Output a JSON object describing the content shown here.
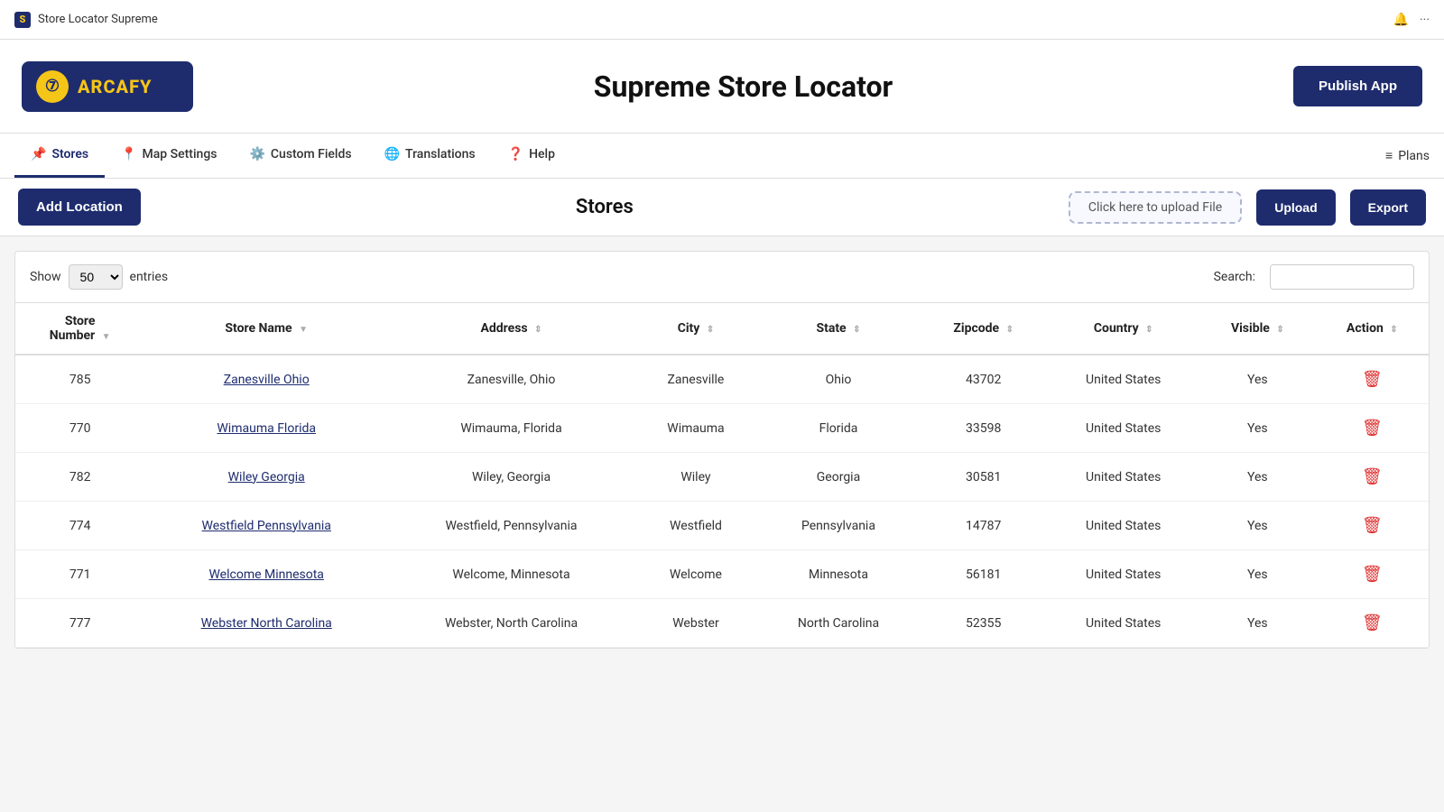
{
  "topbar": {
    "title": "Store Locator Supreme",
    "bell_icon": "🔔",
    "more_icon": "···"
  },
  "header": {
    "logo_text": "ARCAFY",
    "logo_icon_char": "⑦",
    "title": "Supreme Store Locator",
    "publish_label": "Publish App"
  },
  "nav": {
    "tabs": [
      {
        "id": "stores",
        "icon": "📌",
        "label": "Stores",
        "active": true
      },
      {
        "id": "map-settings",
        "icon": "📍",
        "label": "Map Settings",
        "active": false
      },
      {
        "id": "custom-fields",
        "icon": "⚙️",
        "label": "Custom Fields",
        "active": false
      },
      {
        "id": "translations",
        "icon": "🌐",
        "label": "Translations",
        "active": false
      },
      {
        "id": "help",
        "icon": "❓",
        "label": "Help",
        "active": false
      }
    ],
    "plans_label": "Plans",
    "plans_icon": "≡"
  },
  "toolbar": {
    "add_location_label": "Add Location",
    "page_title": "Stores",
    "upload_file_placeholder": "Click here to upload File",
    "upload_label": "Upload",
    "export_label": "Export"
  },
  "table_controls": {
    "show_label": "Show",
    "entries_value": "50",
    "entries_label": "entries",
    "search_label": "Search:"
  },
  "table": {
    "columns": [
      {
        "id": "store-number",
        "label": "Store\nNumber",
        "sortable": true
      },
      {
        "id": "store-name",
        "label": "Store Name",
        "sortable": true
      },
      {
        "id": "address",
        "label": "Address",
        "sortable": true
      },
      {
        "id": "city",
        "label": "City",
        "sortable": true
      },
      {
        "id": "state",
        "label": "State",
        "sortable": true
      },
      {
        "id": "zipcode",
        "label": "Zipcode",
        "sortable": true
      },
      {
        "id": "country",
        "label": "Country",
        "sortable": true
      },
      {
        "id": "visible",
        "label": "Visible",
        "sortable": true
      },
      {
        "id": "action",
        "label": "Action",
        "sortable": true
      }
    ],
    "rows": [
      {
        "number": "785",
        "name": "Zanesville Ohio",
        "address": "Zanesville, Ohio",
        "city": "Zanesville",
        "state": "Ohio",
        "zipcode": "43702",
        "country": "United States",
        "visible": "Yes"
      },
      {
        "number": "770",
        "name": "Wimauma Florida",
        "address": "Wimauma, Florida",
        "city": "Wimauma",
        "state": "Florida",
        "zipcode": "33598",
        "country": "United States",
        "visible": "Yes"
      },
      {
        "number": "782",
        "name": "Wiley Georgia",
        "address": "Wiley, Georgia",
        "city": "Wiley",
        "state": "Georgia",
        "zipcode": "30581",
        "country": "United States",
        "visible": "Yes"
      },
      {
        "number": "774",
        "name": "Westfield Pennsylvania",
        "address": "Westfield, Pennsylvania",
        "city": "Westfield",
        "state": "Pennsylvania",
        "zipcode": "14787",
        "country": "United States",
        "visible": "Yes"
      },
      {
        "number": "771",
        "name": "Welcome Minnesota",
        "address": "Welcome, Minnesota",
        "city": "Welcome",
        "state": "Minnesota",
        "zipcode": "56181",
        "country": "United States",
        "visible": "Yes"
      },
      {
        "number": "777",
        "name": "Webster North Carolina",
        "address": "Webster, North Carolina",
        "city": "Webster",
        "state": "North Carolina",
        "zipcode": "52355",
        "country": "United States",
        "visible": "Yes"
      }
    ]
  }
}
